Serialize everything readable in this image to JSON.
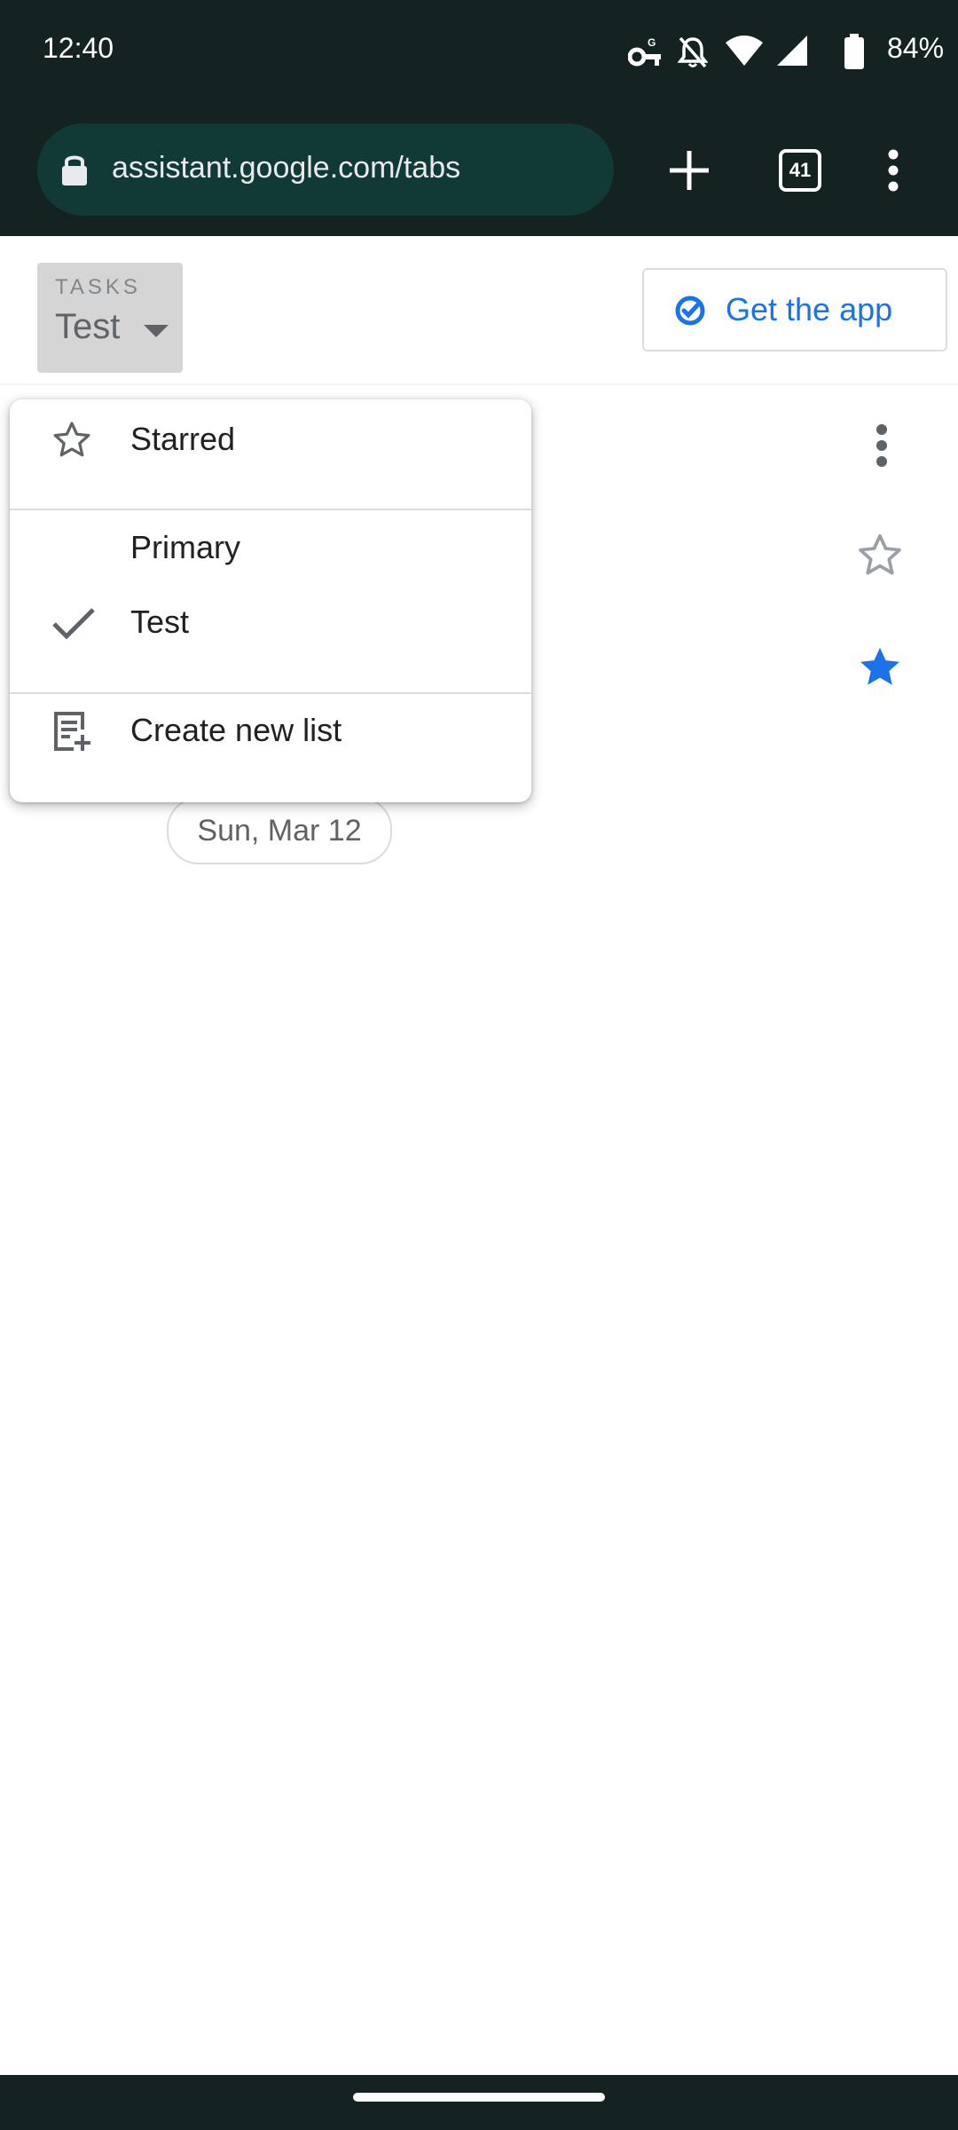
{
  "status_bar": {
    "time": "12:40",
    "battery": "84%",
    "icons": [
      "vpn-key-icon",
      "notifications-off-icon",
      "wifi-icon",
      "signal-icon",
      "battery-icon"
    ]
  },
  "browser": {
    "url": "assistant.google.com/tabs",
    "tab_count": "41"
  },
  "header": {
    "caption": "TASKS",
    "selected_list": "Test",
    "get_app_label": "Get the app"
  },
  "background": {
    "date_chip": "Sun, Mar 12"
  },
  "menu": {
    "items": [
      {
        "label": "Starred",
        "icon": "star-outline-icon"
      },
      {
        "label": "Primary",
        "icon": ""
      },
      {
        "label": "Test",
        "icon": "check-icon",
        "selected": true
      },
      {
        "label": "Create new list",
        "icon": "playlist-add-icon"
      }
    ]
  },
  "colors": {
    "system_bar": "#142221",
    "url_bar": "#113a36",
    "accent": "#1a73e8"
  }
}
